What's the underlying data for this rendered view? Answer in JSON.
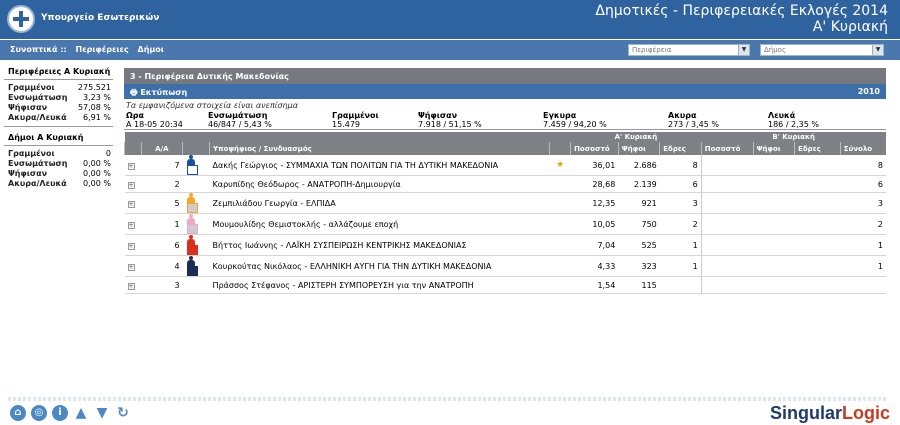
{
  "header": {
    "ministry": "Υπουργείο Εσωτερικών",
    "title_line1": "Δημοτικές - Περιφερειακές Εκλογές 2014",
    "title_line2": "Α' Κυριακή"
  },
  "nav": {
    "links": [
      "Συνοπτικά ::",
      "Περιφέρειες",
      "Δήμοι"
    ],
    "region_select": "Περιφέρεια",
    "municipality_select": "Δήμος"
  },
  "left": {
    "regions_title": "Περιφέρειες Α Κυριακή",
    "regions": [
      {
        "k": "Γραμμένοι",
        "v": "275.521"
      },
      {
        "k": "Ενσωμάτωση",
        "v": "3,23 %"
      },
      {
        "k": "Ψήφισαν",
        "v": "57,08 %"
      },
      {
        "k": "Ακυρα/Λευκά",
        "v": "6,91 %"
      }
    ],
    "munis_title": "Δήμοι Α Κυριακή",
    "munis": [
      {
        "k": "Γραμμένοι",
        "v": "0"
      },
      {
        "k": "Ενσωμάτωση",
        "v": "0,00 %"
      },
      {
        "k": "Ψήφισαν",
        "v": "0,00 %"
      },
      {
        "k": "Ακυρα/Λευκά",
        "v": "0,00 %"
      }
    ]
  },
  "main": {
    "region_title": "3 - Περιφέρεια Δυτικής Μακεδονίας",
    "print_label": "Εκτύπωση",
    "year": "2010",
    "note": "Τα εμφανιζόμενα στοιχεία είναι ανεπίσημα",
    "stats_headers": [
      "Ωρα",
      "Ενσωμάτωση",
      "Γραμμένοι",
      "Ψήφισαν",
      "Εγκυρα",
      "Ακυρα",
      "Λευκά"
    ],
    "stats_values": [
      "Α  18-05 20:34",
      "46/847 / 5,43 %",
      "15.479",
      "7.918 / 51,15 %",
      "7.459 / 94,20 %",
      "273 / 3,45 %",
      "186 / 2,35 %"
    ],
    "round_a": "Α' Κυριακή",
    "round_b": "Β' Κυριακή",
    "col_aa": "Α/Α",
    "col_candidate": "Υποψήφιος / Συνδυασμός",
    "cols_a": [
      "Ποσοστό",
      "Ψήφοι",
      "Εδρες"
    ],
    "cols_b": [
      "Ποσοστό",
      "Ψήφοι",
      "Εδρες",
      "Σύνολο"
    ],
    "rows": [
      {
        "aa": "7",
        "name": "Δακής Γεώργιος - ΣΥΜΜΑΧΙΑ ΤΩΝ ΠΟΛΙΤΩΝ ΓΙΑ ΤΗ ΔΥΤΙΚΗ ΜΑΚΕΔΟΝΙΑ",
        "star": "★",
        "pct": "36,01",
        "votes": "2.686",
        "seats": "8",
        "total": "8",
        "color": "#1a4fa0",
        "color2": "#ffffff"
      },
      {
        "aa": "2",
        "name": "Καρυπίδης Θεόδωρος - ΑΝΑΤΡΟΠΗ-Δημιουργία",
        "star": "",
        "pct": "28,68",
        "votes": "2.139",
        "seats": "6",
        "total": "6",
        "color": "",
        "color2": ""
      },
      {
        "aa": "5",
        "name": "Ζεμπιλιάδου Γεωργία - ΕΛΠΙΔΑ",
        "star": "",
        "pct": "12,35",
        "votes": "921",
        "seats": "3",
        "total": "3",
        "color": "#f5a623",
        "color2": "#cccccc"
      },
      {
        "aa": "1",
        "name": "Μουμουλίδης Θεμιστοκλής - αλλάζουμε εποχή",
        "star": "",
        "pct": "10,05",
        "votes": "750",
        "seats": "2",
        "total": "2",
        "color": "#f0a8c8",
        "color2": "#cccccc"
      },
      {
        "aa": "6",
        "name": "Βήττος Ιωάννης - ΛΑΪΚΗ ΣΥΣΠΕΙΡΩΣΗ ΚΕΝΤΡΙΚΗΣ ΜΑΚΕΔΟΝΙΑΣ",
        "star": "",
        "pct": "7,04",
        "votes": "525",
        "seats": "1",
        "total": "1",
        "color": "#d9301c",
        "color2": "#d9301c"
      },
      {
        "aa": "4",
        "name": "Κουρκούτας Νικόλαος - ΕΛΛΗΝΙΚΗ ΑΥΓΗ ΓΙΑ ΤΗΝ ΔΥΤΙΚΗ ΜΑΚΕΔΟΝΙΑ",
        "star": "",
        "pct": "4,33",
        "votes": "323",
        "seats": "1",
        "total": "1",
        "color": "#1b2c55",
        "color2": "#1b2c55"
      },
      {
        "aa": "3",
        "name": "Πράσσος Στέφανος - ΑΡΙΣΤΕΡΗ ΣΥΜΠΟΡΕΥΣΗ για την ΑΝΑΤΡΟΠΗ",
        "star": "",
        "pct": "1,54",
        "votes": "115",
        "seats": "",
        "total": "",
        "color": "",
        "color2": ""
      }
    ]
  },
  "footer": {
    "icons": [
      "home-icon",
      "globe-icon",
      "info-icon",
      "arrow-up-icon",
      "arrow-down-icon",
      "refresh-icon"
    ],
    "brand_a": "Singular",
    "brand_b": "Logic"
  }
}
